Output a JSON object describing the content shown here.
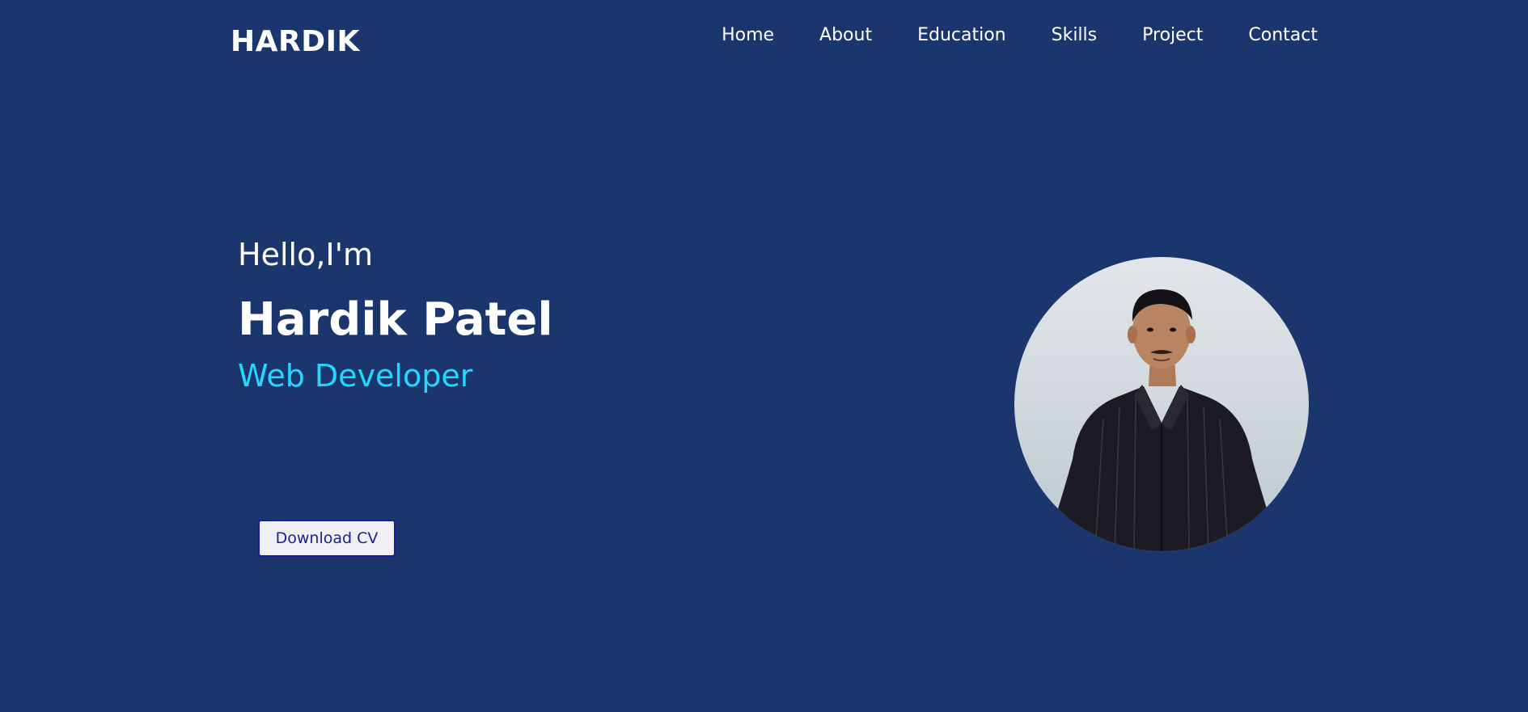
{
  "header": {
    "logo": "HARDIK",
    "nav": [
      "Home",
      "About",
      "Education",
      "Skills",
      "Project",
      "Contact"
    ]
  },
  "hero": {
    "greeting": "Hello,I'm",
    "name": "Hardik Patel",
    "role": "Web Developer",
    "cv_button": "Download CV"
  },
  "colors": {
    "background": "#1b366d",
    "accent": "#22d8ff",
    "text": "#ffffff",
    "button_bg": "#f0eff5",
    "button_text": "#1e1e8c"
  },
  "icons": {
    "profile_photo": "person-portrait"
  }
}
